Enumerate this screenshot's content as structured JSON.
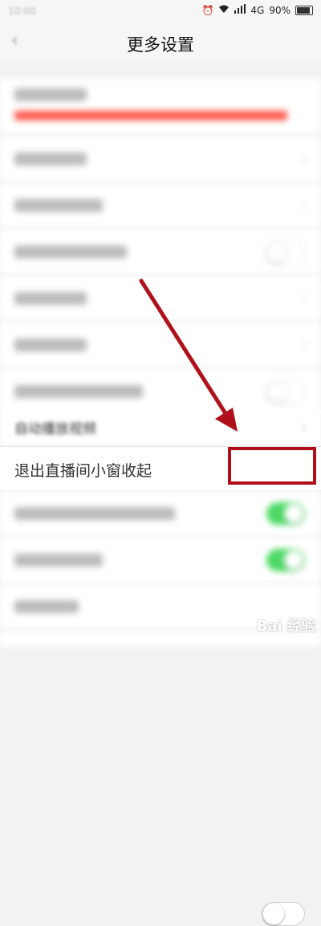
{
  "status_bar": {
    "network": "4G",
    "battery": "90%"
  },
  "header": {
    "title": "更多设置"
  },
  "focus_row": {
    "label": "退出直播间小窗收起",
    "toggle_state": "off"
  },
  "partially_visible_row": {
    "label": "自动播放视频"
  },
  "colors": {
    "highlight_box": "#b0101a",
    "arrow": "#b0101a",
    "toggle_on": "#4cd964"
  },
  "watermark": {
    "text": "Bai 经验"
  }
}
